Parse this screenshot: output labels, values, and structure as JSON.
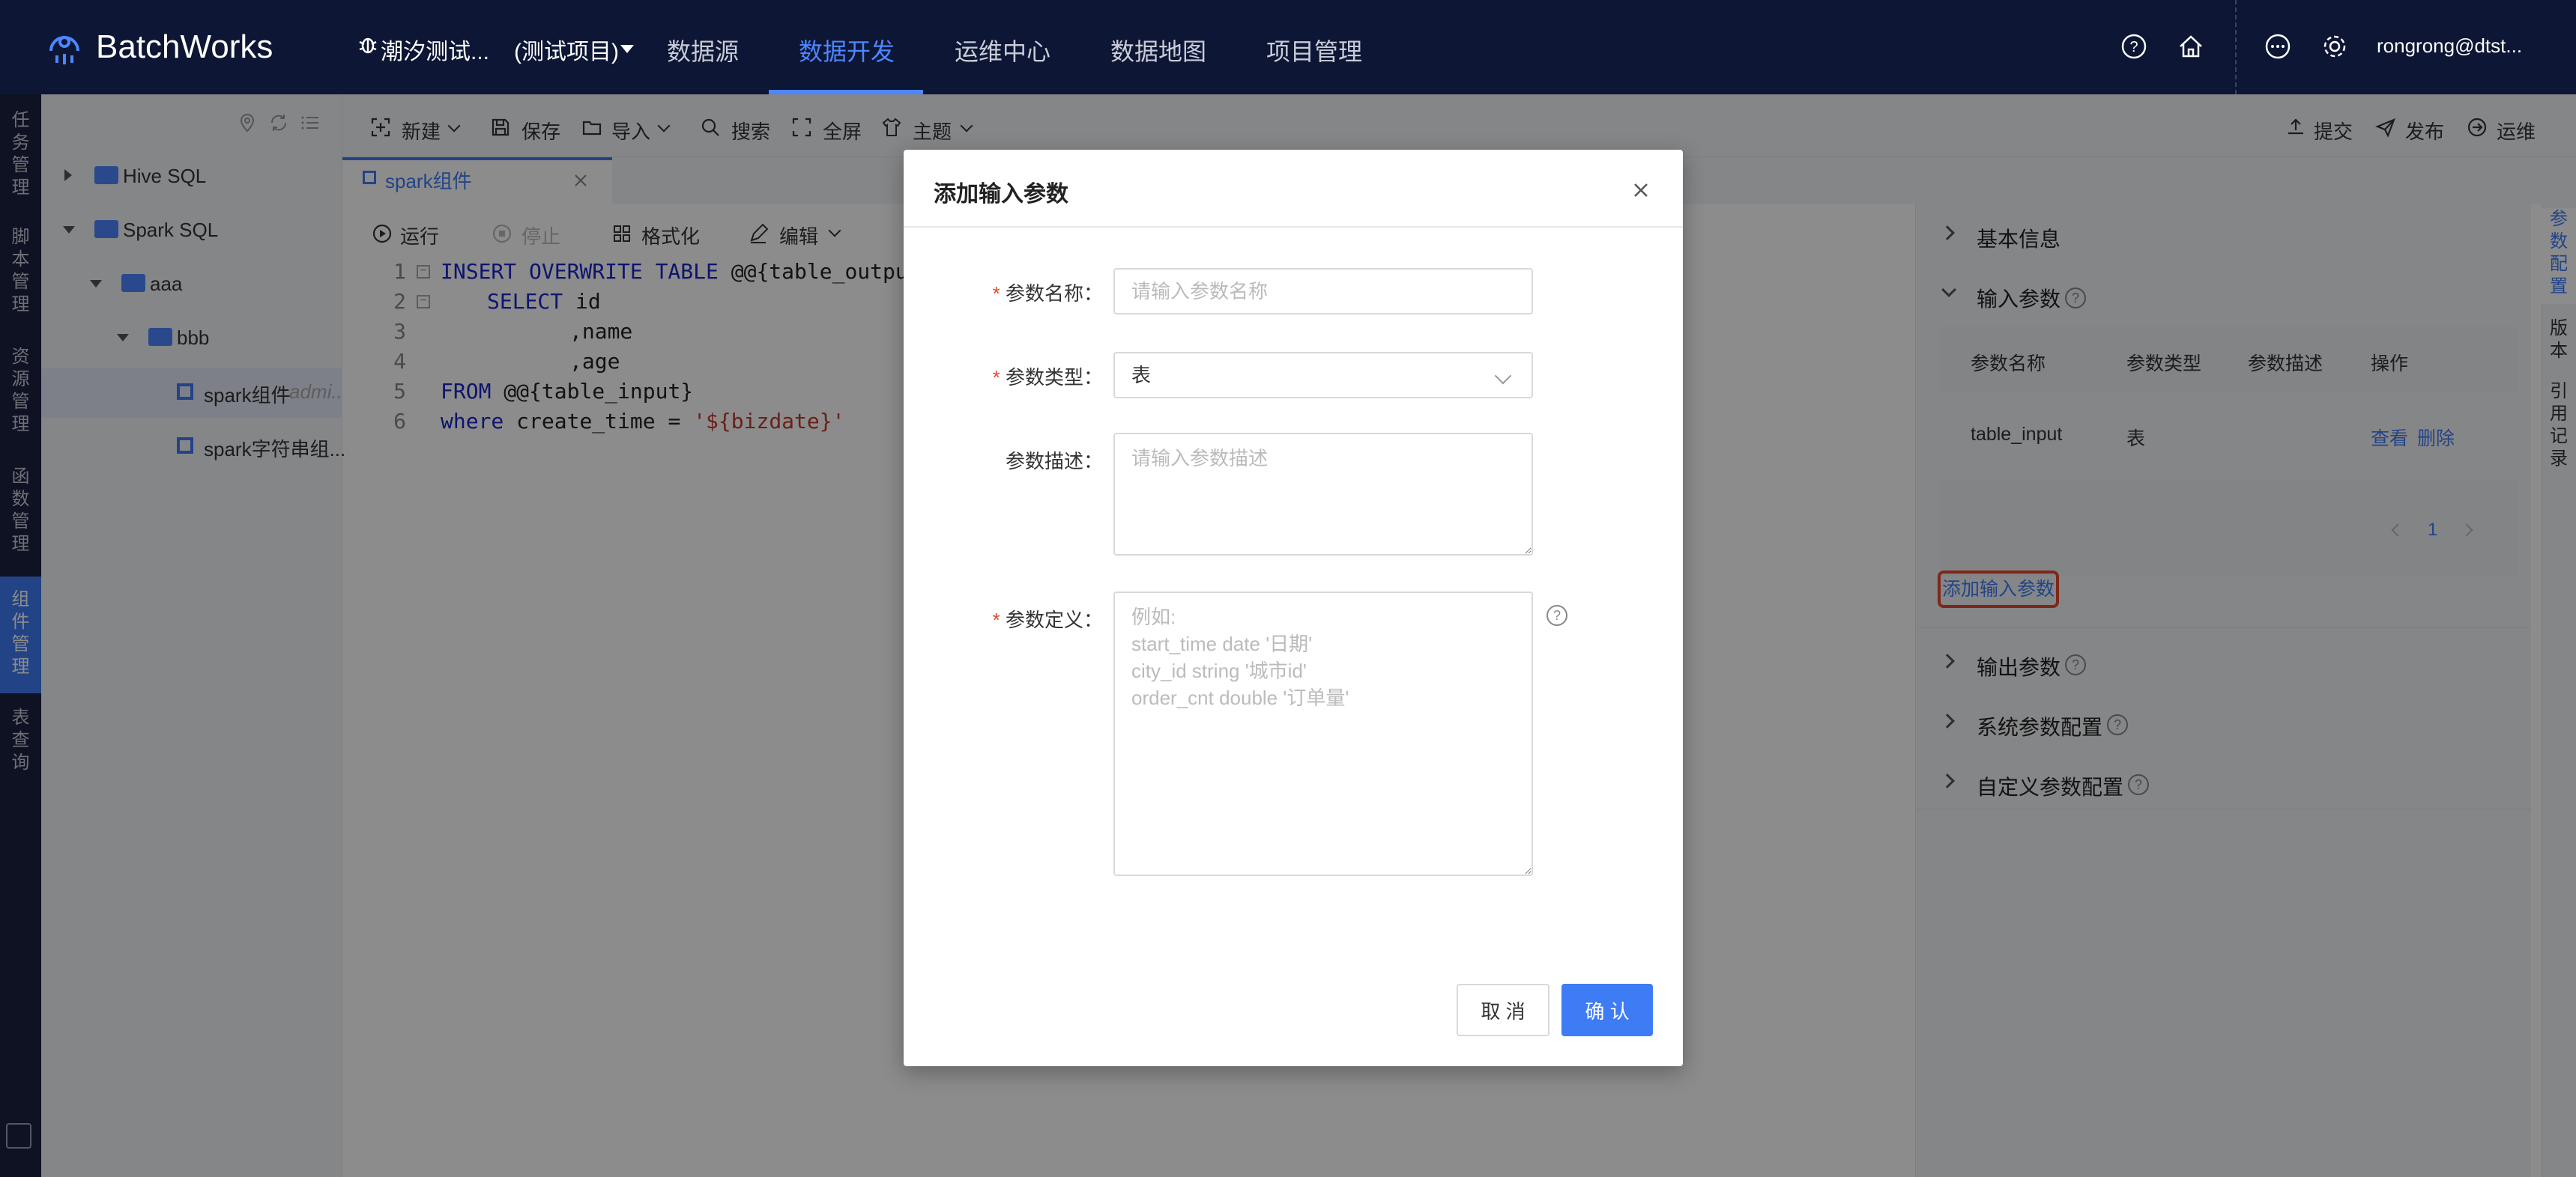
{
  "app": {
    "title": "BatchWorks"
  },
  "project": {
    "name": "潮汐测试...",
    "scope": "(测试项目)"
  },
  "nav": [
    {
      "label": "数据源",
      "active": false
    },
    {
      "label": "数据开发",
      "active": true
    },
    {
      "label": "运维中心",
      "active": false
    },
    {
      "label": "数据地图",
      "active": false
    },
    {
      "label": "项目管理",
      "active": false
    }
  ],
  "user": {
    "name": "rongrong@dtst..."
  },
  "left_tabs": [
    "任务管理",
    "脚本管理",
    "资源管理",
    "函数管理",
    "组件管理",
    "表查询"
  ],
  "left_tab_active": "组件管理",
  "tree": {
    "items": [
      {
        "label": "Hive SQL"
      },
      {
        "label": "Spark SQL"
      },
      {
        "label": "aaa"
      },
      {
        "label": "bbb"
      },
      {
        "label": "spark组件",
        "owner": "admi..."
      },
      {
        "label": "spark字符串组..."
      }
    ]
  },
  "toolbar": {
    "new": "新建",
    "save": "保存",
    "import": "导入",
    "search": "搜索",
    "fullscreen": "全屏",
    "theme": "主题",
    "submit": "提交",
    "publish": "发布",
    "ops": "运维"
  },
  "tab": {
    "label": "spark组件"
  },
  "editor_toolbar": {
    "run": "运行",
    "stop": "停止",
    "format": "格式化",
    "edit": "编辑"
  },
  "code": {
    "line_numbers": [
      "1",
      "2",
      "3",
      "4",
      "5",
      "6"
    ],
    "l1_kw": "INSERT OVERWRITE TABLE",
    "l1_rest": " @@{table_output}",
    "l2_kw": "SELECT",
    "l2_rest": " id",
    "l3": ",name",
    "l4": ",age",
    "l5_kw": "FROM",
    "l5_rest": " @@{table_input}",
    "l6_kw": "where",
    "l6_mid": " create_time = ",
    "l6_str": "'${bizdate}'"
  },
  "right_panel": {
    "basic_info": "基本信息",
    "input_params": "输入参数",
    "columns": [
      "参数名称",
      "参数类型",
      "参数描述",
      "操作"
    ],
    "row": {
      "name": "table_input",
      "type": "表",
      "desc": "",
      "view": "查看",
      "delete": "删除"
    },
    "page": "1",
    "add_link": "添加输入参数",
    "output_params": "输出参数",
    "system_params": "系统参数配置",
    "custom_params": "自定义参数配置"
  },
  "right_tabs": [
    "参数配置",
    "版本",
    "引用记录"
  ],
  "modal": {
    "title": "添加输入参数",
    "name_label": "参数名称",
    "name_placeholder": "请输入参数名称",
    "type_label": "参数类型",
    "type_value": "表",
    "desc_label": "参数描述",
    "desc_placeholder": "请输入参数描述",
    "def_label": "参数定义",
    "def_placeholder": "例如:\nstart_time date '日期'\ncity_id string '城市id'\norder_cnt double '订单量'",
    "cancel": "取 消",
    "ok": "确 认"
  },
  "colors": {
    "accent": "#3e7cf5",
    "topbar": "#0d1634",
    "highlight": "#e8472b"
  }
}
